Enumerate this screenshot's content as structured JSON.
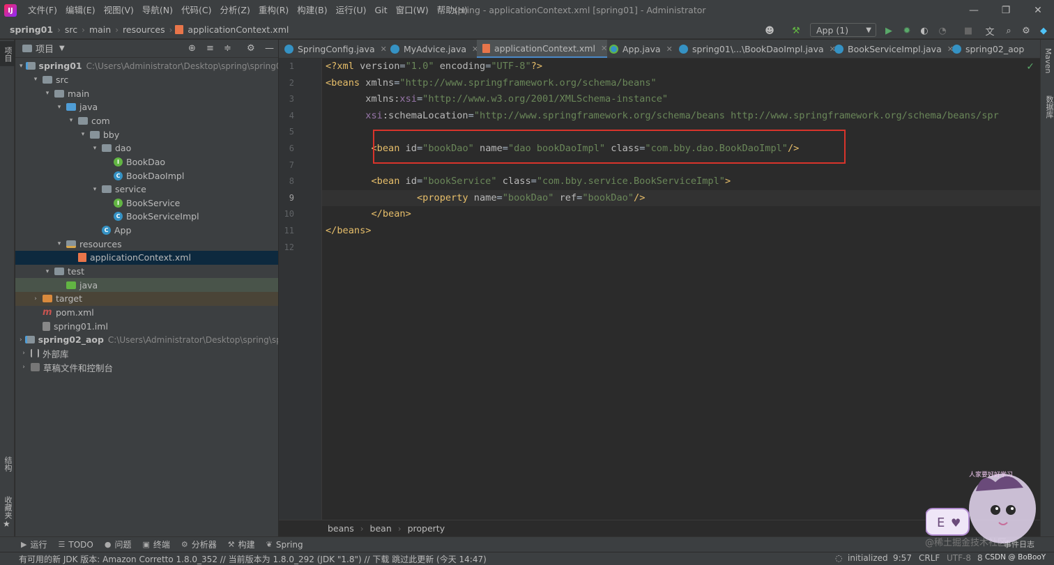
{
  "menu": [
    "文件(F)",
    "编辑(E)",
    "视图(V)",
    "导航(N)",
    "代码(C)",
    "分析(Z)",
    "重构(R)",
    "构建(B)",
    "运行(U)",
    "Git",
    "窗口(W)",
    "帮助(H)"
  ],
  "window_title": "spring - applicationContext.xml [spring01] - Administrator",
  "breadcrumbs": [
    "spring01",
    "src",
    "main",
    "resources",
    "applicationContext.xml"
  ],
  "run_config": "App (1)",
  "left_stripe": {
    "project": "项目",
    "structure": "结构",
    "favorites": "收藏夹"
  },
  "right_stripe": {
    "maven": "Maven",
    "database": "数据库"
  },
  "project_panel": {
    "title": "项目",
    "tree": [
      {
        "label": "spring01",
        "path": "C:\\Users\\Administrator\\Desktop\\spring\\spring01",
        "depth": 0,
        "arrow": "▾",
        "icon": "module",
        "bold": true
      },
      {
        "label": "src",
        "depth": 1,
        "arrow": "▾",
        "icon": "folder"
      },
      {
        "label": "main",
        "depth": 2,
        "arrow": "▾",
        "icon": "folder"
      },
      {
        "label": "java",
        "depth": 3,
        "arrow": "▾",
        "icon": "folder-blue"
      },
      {
        "label": "com",
        "depth": 4,
        "arrow": "▾",
        "icon": "folder"
      },
      {
        "label": "bby",
        "depth": 5,
        "arrow": "▾",
        "icon": "folder"
      },
      {
        "label": "dao",
        "depth": 6,
        "arrow": "▾",
        "icon": "folder"
      },
      {
        "label": "BookDao",
        "depth": 7,
        "arrow": "",
        "icon": "interface"
      },
      {
        "label": "BookDaoImpl",
        "depth": 7,
        "arrow": "",
        "icon": "class"
      },
      {
        "label": "service",
        "depth": 6,
        "arrow": "▾",
        "icon": "folder"
      },
      {
        "label": "BookService",
        "depth": 7,
        "arrow": "",
        "icon": "interface"
      },
      {
        "label": "BookServiceImpl",
        "depth": 7,
        "arrow": "",
        "icon": "class"
      },
      {
        "label": "App",
        "depth": 6,
        "arrow": "",
        "icon": "class"
      },
      {
        "label": "resources",
        "depth": 3,
        "arrow": "▾",
        "icon": "folder-res"
      },
      {
        "label": "applicationContext.xml",
        "depth": 4,
        "arrow": "",
        "icon": "xml",
        "selected": true
      },
      {
        "label": "test",
        "depth": 2,
        "arrow": "▾",
        "icon": "folder"
      },
      {
        "label": "java",
        "depth": 3,
        "arrow": "",
        "icon": "folder-green",
        "row": "test-java"
      },
      {
        "label": "target",
        "depth": 1,
        "arrow": "›",
        "icon": "folder-orange",
        "row": "target-row"
      },
      {
        "label": "pom.xml",
        "depth": 1,
        "arrow": "",
        "icon": "maven"
      },
      {
        "label": "spring01.iml",
        "depth": 1,
        "arrow": "",
        "icon": "iml"
      },
      {
        "label": "spring02_aop",
        "path": "C:\\Users\\Administrator\\Desktop\\spring\\spr",
        "depth": 0,
        "arrow": "›",
        "icon": "module",
        "bold": true
      },
      {
        "label": "外部库",
        "depth": 0,
        "arrow": "›",
        "icon": "lib"
      },
      {
        "label": "草稿文件和控制台",
        "depth": 0,
        "arrow": "›",
        "icon": "scratch"
      }
    ]
  },
  "tabs": [
    {
      "label": "SpringConfig.java",
      "icon": "class"
    },
    {
      "label": "MyAdvice.java",
      "icon": "class"
    },
    {
      "label": "applicationContext.xml",
      "icon": "xml",
      "active": true
    },
    {
      "label": "App.java",
      "icon": "app"
    },
    {
      "label": "spring01\\...\\BookDaoImpl.java",
      "icon": "class"
    },
    {
      "label": "BookServiceImpl.java",
      "icon": "class"
    },
    {
      "label": "spring02_aop",
      "icon": "class"
    }
  ],
  "editor": {
    "line_numbers": [
      "1",
      "2",
      "3",
      "4",
      "5",
      "6",
      "7",
      "8",
      "9",
      "10",
      "11",
      "12"
    ],
    "current_line": 9,
    "code_lines": [
      [
        [
          "tag",
          "<?xml "
        ],
        [
          "attr",
          "version"
        ],
        [
          "plain",
          "="
        ],
        [
          "val",
          "\"1.0\""
        ],
        [
          "plain",
          " "
        ],
        [
          "attr",
          "encoding"
        ],
        [
          "plain",
          "="
        ],
        [
          "val",
          "\"UTF-8\""
        ],
        [
          "tag",
          "?>"
        ]
      ],
      [
        [
          "tag",
          "<beans "
        ],
        [
          "attr",
          "xmlns"
        ],
        [
          "plain",
          "="
        ],
        [
          "val",
          "\"http://www.springframework.org/schema/beans\""
        ]
      ],
      [
        [
          "plain",
          "       "
        ],
        [
          "attr",
          "xmlns:"
        ],
        [
          "ns",
          "xsi"
        ],
        [
          "plain",
          "="
        ],
        [
          "val",
          "\"http://www.w3.org/2001/XMLSchema-instance\""
        ]
      ],
      [
        [
          "plain",
          "       "
        ],
        [
          "ns",
          "xsi"
        ],
        [
          "attr",
          ":schemaLocation"
        ],
        [
          "plain",
          "="
        ],
        [
          "val",
          "\"http://www.springframework.org/schema/beans http://www.springframework.org/schema/beans/spr"
        ]
      ],
      [],
      [
        [
          "plain",
          "        "
        ],
        [
          "tag",
          "<bean "
        ],
        [
          "attr",
          "id"
        ],
        [
          "plain",
          "="
        ],
        [
          "val",
          "\"bookDao\""
        ],
        [
          "plain",
          " "
        ],
        [
          "attr",
          "name"
        ],
        [
          "plain",
          "="
        ],
        [
          "val",
          "\"dao bookDaoImpl\""
        ],
        [
          "plain",
          " "
        ],
        [
          "attr",
          "class"
        ],
        [
          "plain",
          "="
        ],
        [
          "val",
          "\"com.bby.dao.BookDaoImpl\""
        ],
        [
          "tag",
          "/>"
        ]
      ],
      [],
      [
        [
          "plain",
          "        "
        ],
        [
          "tag",
          "<bean "
        ],
        [
          "attr",
          "id"
        ],
        [
          "plain",
          "="
        ],
        [
          "val",
          "\"bookService\""
        ],
        [
          "plain",
          " "
        ],
        [
          "attr",
          "class"
        ],
        [
          "plain",
          "="
        ],
        [
          "val",
          "\"com.bby.service.BookServiceImpl\""
        ],
        [
          "tag",
          ">"
        ]
      ],
      [
        [
          "plain",
          "                "
        ],
        [
          "tag",
          "<property "
        ],
        [
          "attr",
          "name"
        ],
        [
          "plain",
          "="
        ],
        [
          "val",
          "\"bookDao\""
        ],
        [
          "plain",
          " "
        ],
        [
          "attr",
          "ref"
        ],
        [
          "plain",
          "="
        ],
        [
          "val",
          "\"bookDao\""
        ],
        [
          "tag",
          "/>"
        ]
      ],
      [
        [
          "plain",
          "        "
        ],
        [
          "tag",
          "</bean>"
        ]
      ],
      [
        [
          "tag",
          "</beans>"
        ]
      ],
      []
    ]
  },
  "editor_breadcrumb": [
    "beans",
    "bean",
    "property"
  ],
  "tool_windows": [
    {
      "label": "运行",
      "icon": "▶"
    },
    {
      "label": "TODO",
      "icon": "☰"
    },
    {
      "label": "问题",
      "icon": "●"
    },
    {
      "label": "终端",
      "icon": "▣"
    },
    {
      "label": "分析器",
      "icon": "⚙"
    },
    {
      "label": "构建",
      "icon": "⚒"
    },
    {
      "label": "Spring",
      "icon": "❦"
    }
  ],
  "status": {
    "message": "有可用的新 JDK 版本: Amazon Corretto 1.8.0_352 // 当前版本为 1.8.0_292 (JDK \"1.8\") // 下载   跳过此更新 (今天 14:47)",
    "initialized": "initialized",
    "position": "9:57",
    "line_sep": "CRLF",
    "encoding": "UTF-8",
    "indent": "8",
    "watermark": "@稀土掘金技术社区",
    "event_log": "事件日志",
    "csdn": "CSDN @ BoBooY"
  },
  "mascot_caption": "人家要好好学习",
  "colors": {
    "accent": "#4a88c7",
    "highlight_box": "#d9342b",
    "tag": "#e8bf6a",
    "string": "#6a8759"
  }
}
